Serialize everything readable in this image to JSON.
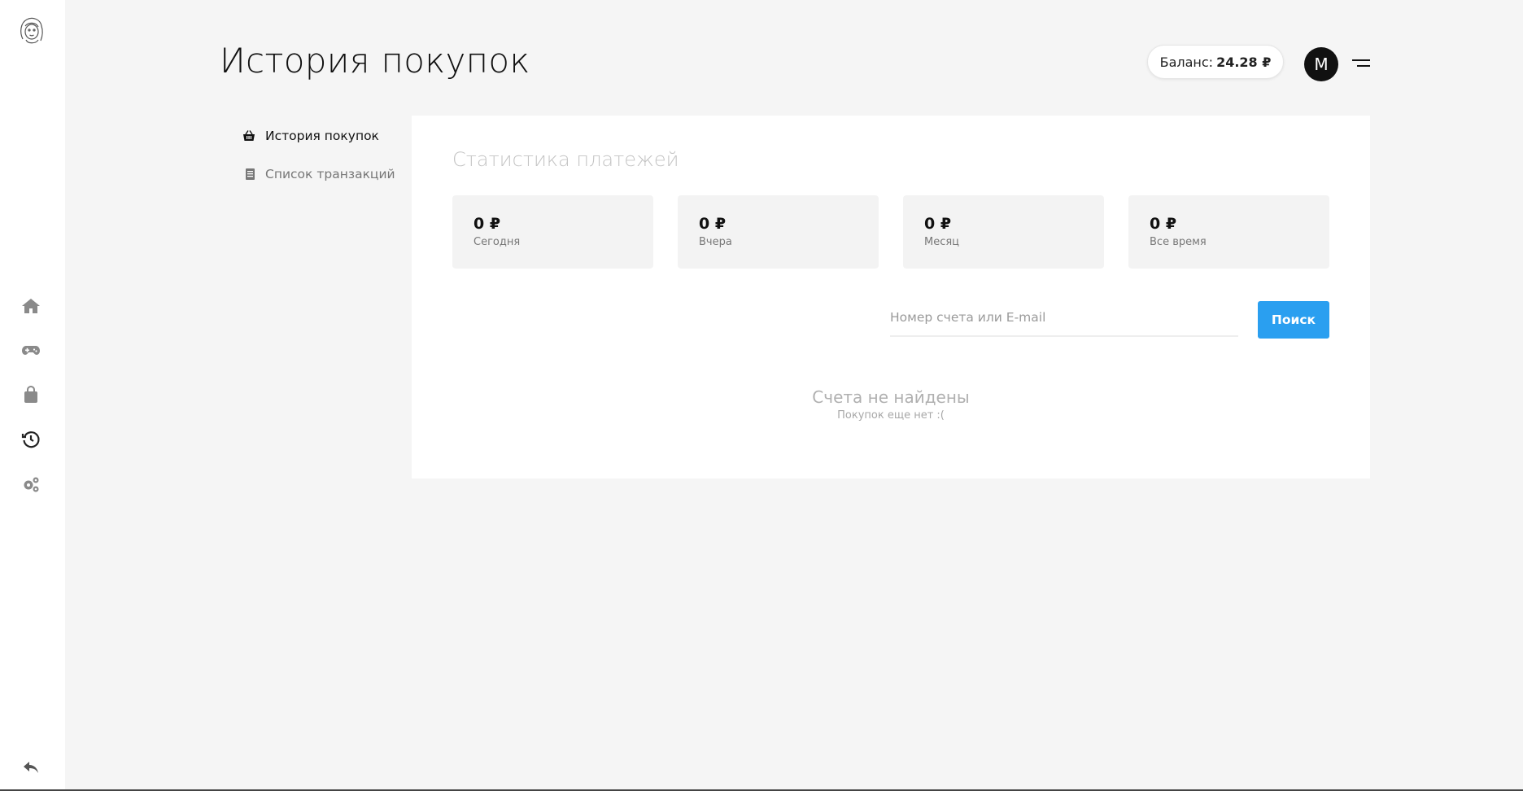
{
  "header": {
    "title": "История покупок",
    "balance_label": "Баланс:",
    "balance_value": "24.28 ₽",
    "avatar_letter": "M"
  },
  "rail": {
    "icons": [
      "logo-portrait-icon",
      "home-icon",
      "gamepad-icon",
      "shopping-bag-icon",
      "history-icon",
      "settings-gears-icon",
      "back-arrow-icon"
    ]
  },
  "subnav": {
    "items": [
      {
        "label": "История покупок",
        "icon": "basket-icon",
        "active": true
      },
      {
        "label": "Список транзакций",
        "icon": "list-icon",
        "active": false
      }
    ]
  },
  "stats": {
    "title": "Статистика платежей",
    "items": [
      {
        "value": "0 ₽",
        "label": "Сегодня"
      },
      {
        "value": "0 ₽",
        "label": "Вчера"
      },
      {
        "value": "0 ₽",
        "label": "Месяц"
      },
      {
        "value": "0 ₽",
        "label": "Все время"
      }
    ]
  },
  "search": {
    "placeholder": "Номер счета или E-mail",
    "button_label": "Поиск"
  },
  "empty": {
    "title": "Счета не найдены",
    "subtitle": "Покупок еще нет :("
  },
  "colors": {
    "accent": "#2a9ff0",
    "background": "#f5f5f5",
    "rail": "#ffffff"
  }
}
